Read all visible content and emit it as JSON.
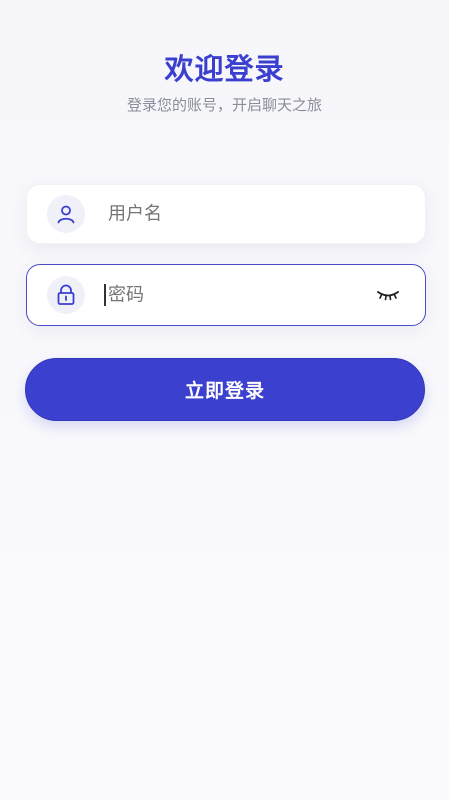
{
  "header": {
    "title": "欢迎登录",
    "subtitle": "登录您的账号，开启聊天之旅"
  },
  "form": {
    "username": {
      "placeholder": "用户名",
      "value": "",
      "icon": "user-icon"
    },
    "password": {
      "placeholder": "密码",
      "value": "",
      "icon": "lock-icon",
      "toggle_icon": "eye-closed-icon"
    },
    "submit_label": "立即登录"
  },
  "colors": {
    "accent": "#3c40cf",
    "icon": "#3b3fcf",
    "background": "#f7f7fb"
  }
}
